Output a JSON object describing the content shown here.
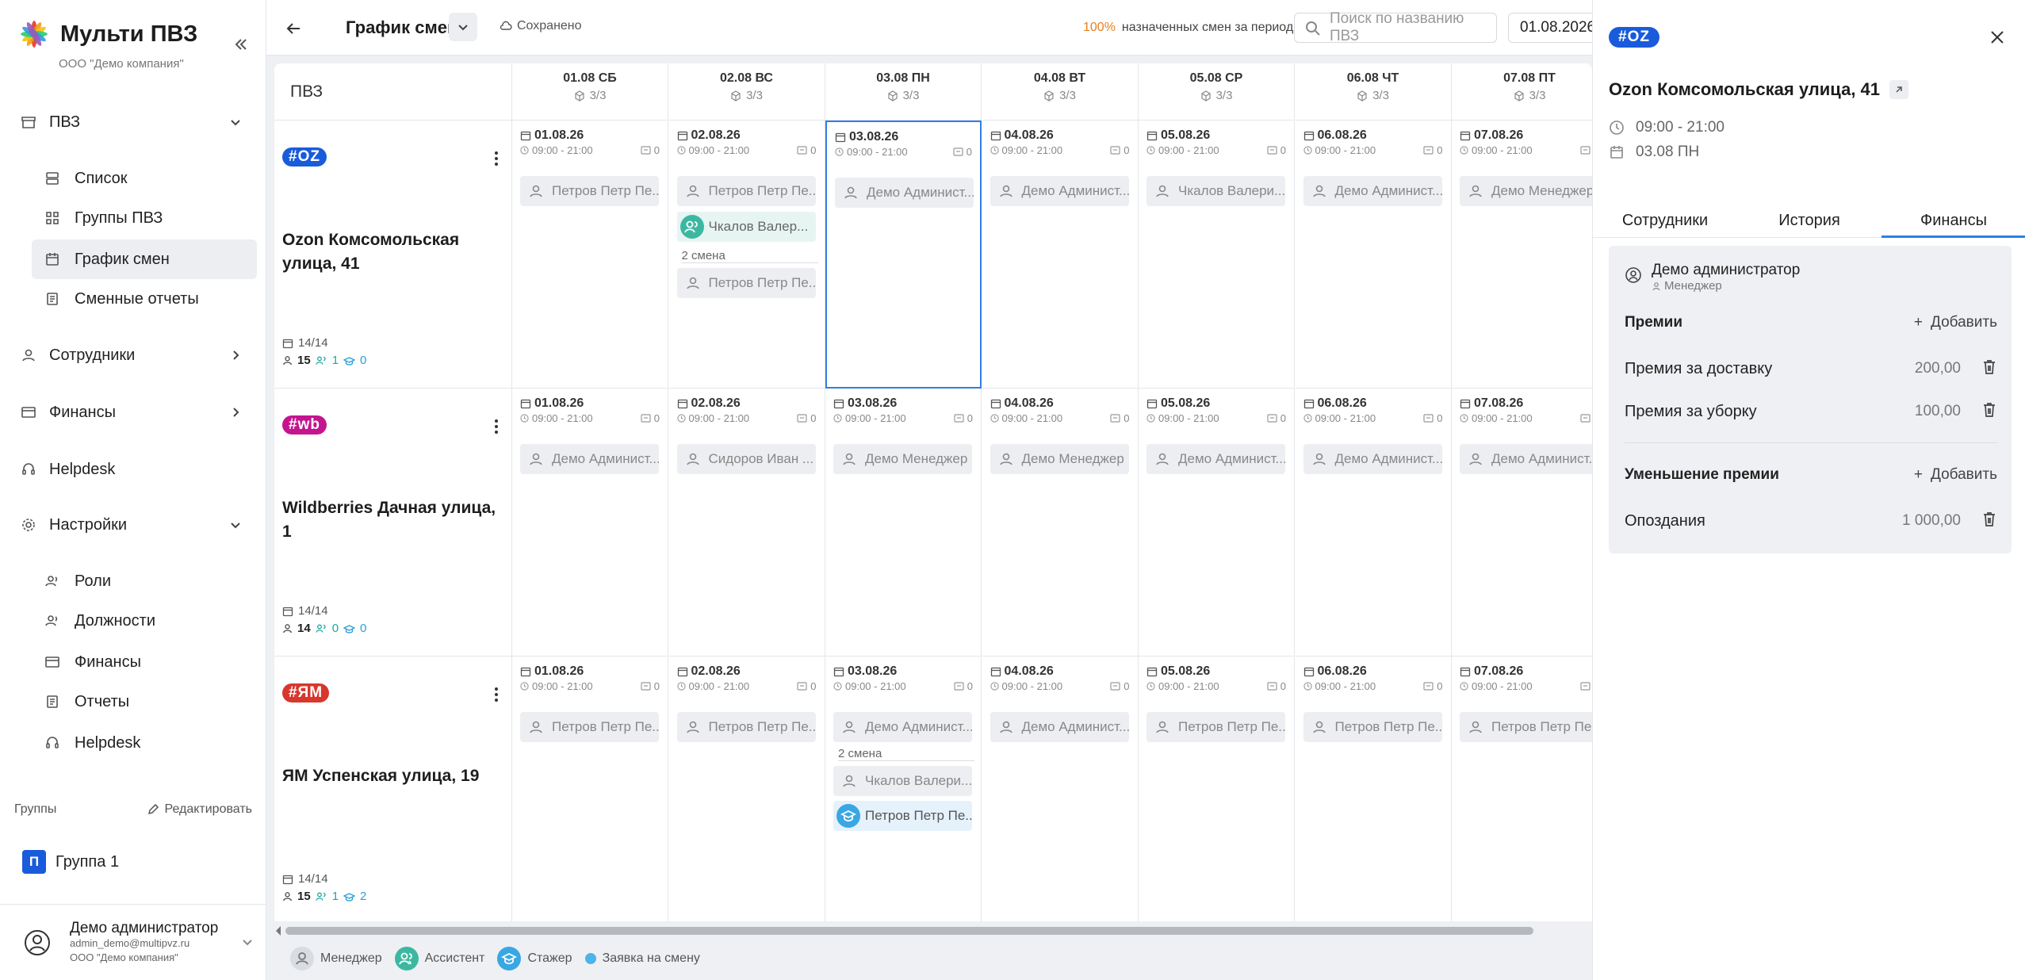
{
  "app": {
    "title": "Мульти ПВЗ",
    "company": "ООО \"Демо компания\""
  },
  "sidebar": {
    "pvz": "ПВЗ",
    "pvz_items": [
      "Список",
      "Группы ПВЗ",
      "График смен",
      "Сменные отчеты"
    ],
    "employees": "Сотрудники",
    "finance": "Финансы",
    "helpdesk": "Helpdesk",
    "settings": "Настройки",
    "settings_items": [
      "Роли",
      "Должности",
      "Финансы",
      "Отчеты",
      "Helpdesk"
    ],
    "groups_label": "Группы",
    "groups_edit": "Редактировать",
    "group1_badge": "П",
    "group1": "Группа 1",
    "user": {
      "name": "Демо администратор",
      "email": "admin_demo@multipvz.ru",
      "company": "ООО \"Демо компания\""
    }
  },
  "topbar": {
    "title": "График смен",
    "saved": "Сохранено",
    "pct": "100%",
    "pct_text": "назначенных смен за период",
    "search_placeholder": "Поиск по названию ПВЗ",
    "date": "01.08.2026 -"
  },
  "grid": {
    "pvz_header": "ПВЗ",
    "days": [
      {
        "d": "01.08 СБ",
        "c": "3/3"
      },
      {
        "d": "02.08 ВС",
        "c": "3/3"
      },
      {
        "d": "03.08 ПН",
        "c": "3/3"
      },
      {
        "d": "04.08 ВТ",
        "c": "3/3"
      },
      {
        "d": "05.08 СР",
        "c": "3/3"
      },
      {
        "d": "06.08 ЧТ",
        "c": "3/3"
      },
      {
        "d": "07.08 ПТ",
        "c": "3/3"
      }
    ],
    "cell_dates": [
      "01.08.26",
      "02.08.26",
      "03.08.26",
      "04.08.26",
      "05.08.26",
      "06.08.26",
      "07.08.26"
    ],
    "time": "09:00 - 21:00",
    "zero": "0",
    "shift2": "2 смена",
    "rows": [
      {
        "badge": "#OZ",
        "color": "#1a5bdb",
        "name": "Ozon Комсомольская улица, 41",
        "slots": "14/14",
        "n1": "15",
        "n2": "1",
        "n3": "0",
        "chips": [
          "Петров Петр Пе...",
          "Петров Петр Пе...",
          "Демо Админист...",
          "Демо Админист...",
          "Чкалов Валери...",
          "Демо Админист...",
          "Демо Менеджер"
        ],
        "extra_asst": "Чкалов Валер...",
        "extra_shift": "Петров Петр Пе..."
      },
      {
        "badge": "#wb",
        "color": "#c4158f",
        "name": "Wildberries Дачная улица, 1",
        "slots": "14/14",
        "n1": "14",
        "n2": "0",
        "n3": "0",
        "chips": [
          "Демо Админист...",
          "Сидоров Иван ...",
          "Демо Менеджер",
          "Демо Менеджер",
          "Демо Админист...",
          "Демо Админист...",
          "Демо Админист..."
        ]
      },
      {
        "badge": "#ЯМ",
        "color": "#d7372c",
        "name": "ЯМ Успенская улица, 19",
        "slots": "14/14",
        "n1": "15",
        "n2": "1",
        "n3": "2",
        "chips": [
          "Петров Петр Пе...",
          "Петров Петр Пе...",
          "Демо Админист...",
          "Демо Админист...",
          "Петров Петр Пе...",
          "Петров Петр Пе...",
          "Петров Петр Пе..."
        ],
        "extra_mgr": "Чкалов Валери...",
        "extra_intern": "Петров Петр Пе..."
      }
    ]
  },
  "legend": {
    "manager": "Менеджер",
    "assistant": "Ассистент",
    "intern": "Стажер",
    "request": "Заявка на смену"
  },
  "panel": {
    "badge": "#OZ",
    "title": "Ozon Комсомольская улица, 41",
    "time": "09:00 - 21:00",
    "date": "03.08 ПН",
    "tabs": [
      "Сотрудники",
      "История",
      "Финансы"
    ],
    "person": "Демо администратор",
    "role": "Менеджер",
    "bonuses": "Премии",
    "add": "Добавить",
    "bonus_items": [
      {
        "label": "Премия за доставку",
        "amount": "200,00"
      },
      {
        "label": "Премия за уборку",
        "amount": "100,00"
      }
    ],
    "reductions": "Уменьшение премии",
    "reduction_items": [
      {
        "label": "Опоздания",
        "amount": "1 000,00"
      }
    ]
  },
  "colors": {
    "accent": "#2f7ee6",
    "ozon": "#1a5bdb",
    "wb": "#c4158f",
    "ym": "#d7372c",
    "assistant": "#1aa9a0",
    "intern": "#2a9fd8"
  }
}
